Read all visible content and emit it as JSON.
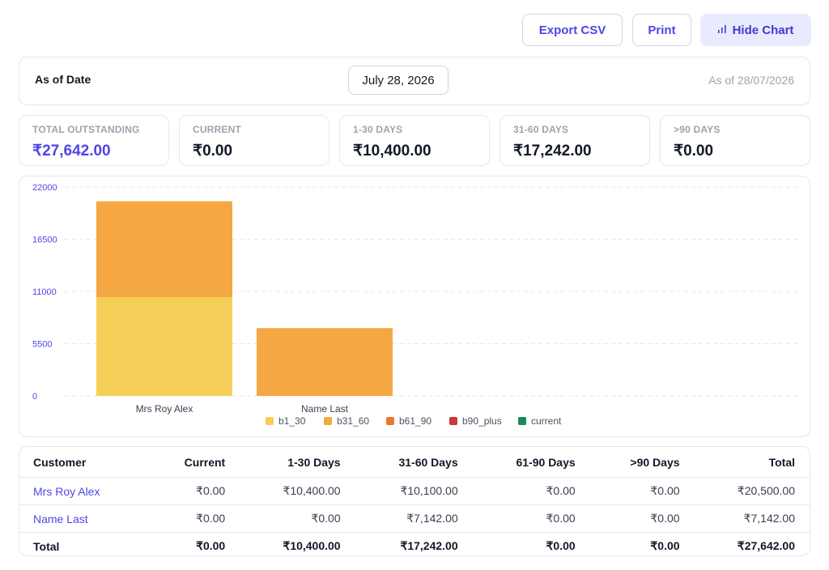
{
  "toolbar": {
    "export_label": "Export CSV",
    "print_label": "Print",
    "hide_chart_label": "Hide Chart"
  },
  "as_of": {
    "label": "As of Date",
    "date_value": "July 28, 2026",
    "as_of_text": "As of 28/07/2026"
  },
  "stats": [
    {
      "label": "TOTAL OUTSTANDING",
      "value": "₹27,642.00"
    },
    {
      "label": "CURRENT",
      "value": "₹0.00"
    },
    {
      "label": "1-30 DAYS",
      "value": "₹10,400.00"
    },
    {
      "label": "31-60 DAYS",
      "value": "₹17,242.00"
    },
    {
      "label": ">90 DAYS",
      "value": "₹0.00"
    }
  ],
  "chart_data": {
    "type": "bar",
    "stacked": true,
    "categories": [
      "Mrs Roy Alex",
      "Name Last"
    ],
    "series": [
      {
        "name": "b1_30",
        "color": "#f5cf57",
        "values": [
          10400,
          0
        ]
      },
      {
        "name": "b31_60",
        "color": "#f4a742",
        "values": [
          10100,
          7142
        ]
      },
      {
        "name": "b61_90",
        "color": "#ea7a2d",
        "values": [
          0,
          0
        ]
      },
      {
        "name": "b90_plus",
        "color": "#c53a3a",
        "values": [
          0,
          0
        ]
      },
      {
        "name": "current",
        "color": "#1e8a5a",
        "values": [
          0,
          0
        ]
      }
    ],
    "yticks": [
      0,
      5500,
      11000,
      16500,
      22000
    ],
    "ylim": [
      0,
      22000
    ],
    "grid": true,
    "legend_position": "bottom",
    "title": "",
    "xlabel": "",
    "ylabel": ""
  },
  "table": {
    "headers": [
      "Customer",
      "Current",
      "1-30 Days",
      "31-60 Days",
      "61-90 Days",
      ">90 Days",
      "Total"
    ],
    "rows": [
      [
        "Mrs Roy Alex",
        "₹0.00",
        "₹10,400.00",
        "₹10,100.00",
        "₹0.00",
        "₹0.00",
        "₹20,500.00"
      ],
      [
        "Name Last",
        "₹0.00",
        "₹0.00",
        "₹7,142.00",
        "₹0.00",
        "₹0.00",
        "₹7,142.00"
      ]
    ],
    "total_row": [
      "Total",
      "₹0.00",
      "₹10,400.00",
      "₹17,242.00",
      "₹0.00",
      "₹0.00",
      "₹27,642.00"
    ]
  },
  "colors": {
    "accent": "#4f46e5",
    "border": "#e5e7eb",
    "muted": "#9ca3af"
  }
}
